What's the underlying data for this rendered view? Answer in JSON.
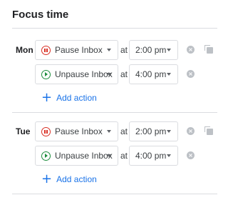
{
  "section": {
    "title": "Focus time",
    "at_label": "at",
    "add_action_label": "Add action"
  },
  "days": [
    {
      "day": "Mon",
      "actions": [
        {
          "action": "Pause Inbox",
          "icon": "pause-icon",
          "time": "2:00 pm"
        },
        {
          "action": "Unpause Inbox",
          "icon": "play-icon",
          "time": "4:00 pm"
        }
      ]
    },
    {
      "day": "Tue",
      "actions": [
        {
          "action": "Pause Inbox",
          "icon": "pause-icon",
          "time": "2:00 pm"
        },
        {
          "action": "Unpause Inbox",
          "icon": "play-icon",
          "time": "4:00 pm"
        }
      ]
    }
  ],
  "colors": {
    "pause": "#d93025",
    "unpause": "#1e8e3e",
    "link": "#1a73e8",
    "border": "#dadce0"
  }
}
